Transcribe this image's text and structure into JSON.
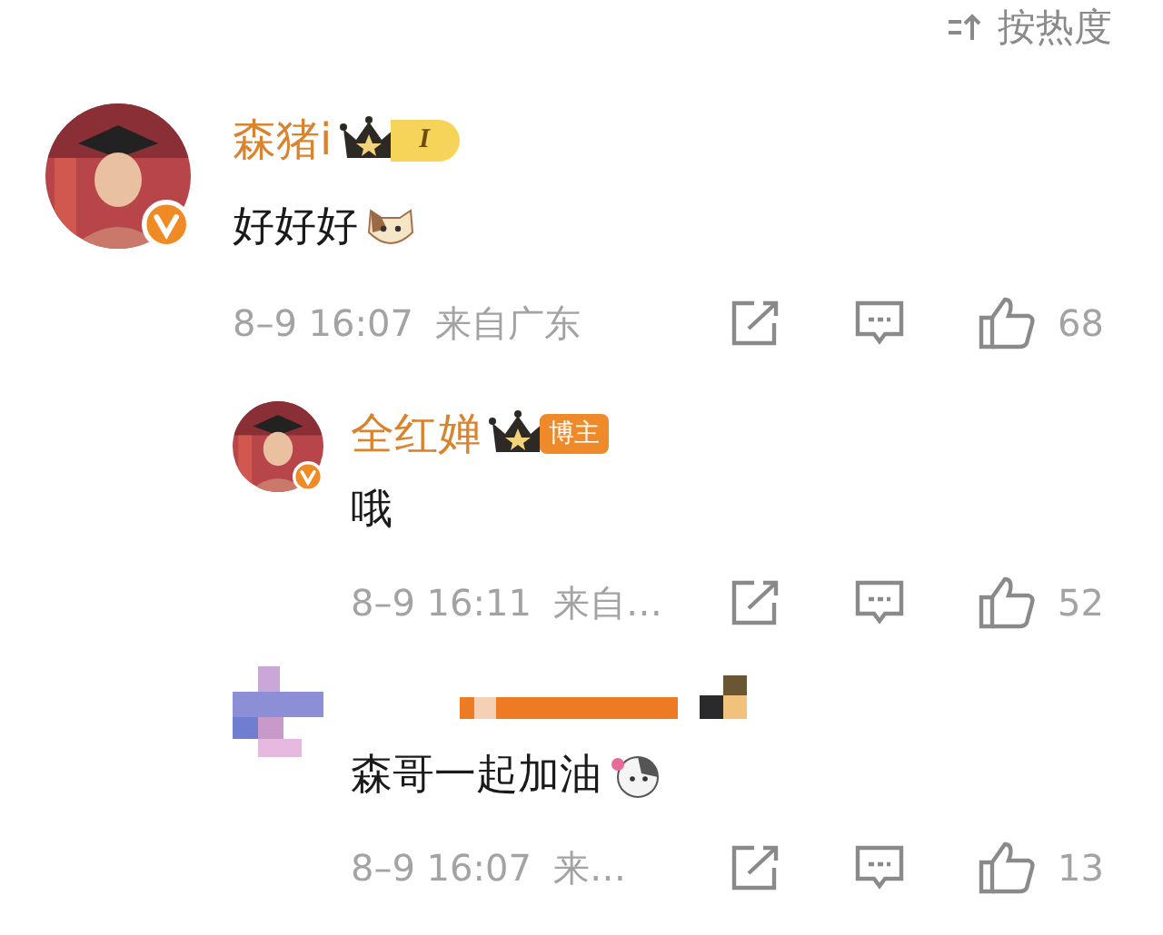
{
  "sort": {
    "label": "按热度"
  },
  "comments": [
    {
      "masked": false,
      "name": "森猪i",
      "badge": {
        "kind": "level",
        "label": "I"
      },
      "text": "好好好",
      "emoji": {
        "kind": "cat"
      },
      "time": "8–9 16:07",
      "location": "来自广东",
      "likes": "68",
      "children": [
        {
          "masked": false,
          "name": "全红婵",
          "badge": {
            "kind": "role",
            "label": "博主"
          },
          "text": "哦",
          "time": "8–9 16:11",
          "location": "来自…",
          "likes": "52"
        },
        {
          "masked": true,
          "text": "森哥一起加油",
          "emoji": {
            "kind": "cat-bow"
          },
          "time": "8–9 16:07",
          "location": "来…",
          "likes": "13"
        }
      ]
    }
  ]
}
